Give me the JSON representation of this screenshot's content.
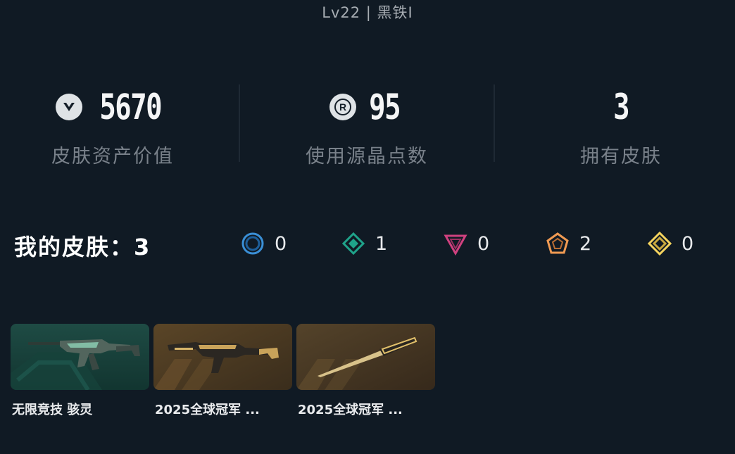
{
  "header": {
    "rank": "Lv22 | 黑铁I"
  },
  "stats": [
    {
      "value": "5670",
      "label": "皮肤资产价值",
      "icon": "valorant-points-icon"
    },
    {
      "value": "95",
      "label": "使用源晶点数",
      "icon": "radianite-points-icon"
    },
    {
      "value": "3",
      "label": "拥有皮肤",
      "icon": ""
    }
  ],
  "skins": {
    "title": "我的皮肤：3",
    "tiers": [
      {
        "icon": "select-tier-icon",
        "color": "#3a8fd6",
        "count": "0"
      },
      {
        "icon": "deluxe-tier-icon",
        "color": "#1fa38a",
        "count": "1"
      },
      {
        "icon": "premium-tier-icon",
        "color": "#d0417f",
        "count": "0"
      },
      {
        "icon": "exclusive-tier-icon",
        "color": "#f09a52",
        "count": "2"
      },
      {
        "icon": "ultra-tier-icon",
        "color": "#f4d35e",
        "count": "0"
      }
    ],
    "items": [
      {
        "name": "无限竞技 骇灵",
        "theme": "#1e3a34"
      },
      {
        "name": "2025全球冠军 ...",
        "theme": "#4a3a22"
      },
      {
        "name": "2025全球冠军 ...",
        "theme": "#4a3a22"
      }
    ]
  }
}
